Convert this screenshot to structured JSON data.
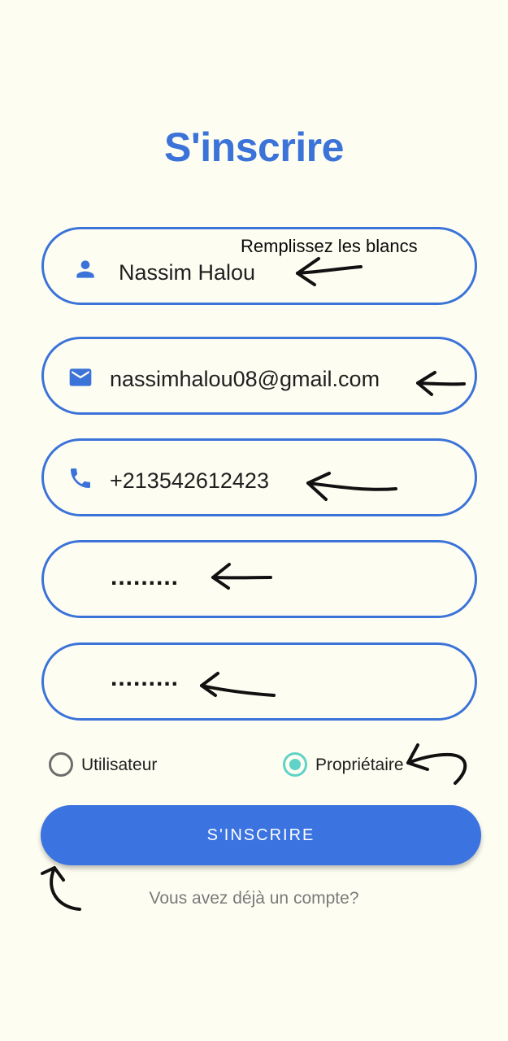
{
  "header": {
    "title": "S'inscrire"
  },
  "annotation": {
    "text": "Remplissez les blancs"
  },
  "form": {
    "name": {
      "value": "Nassim Halou",
      "icon": "person-icon"
    },
    "email": {
      "value": "nassimhalou08@gmail.com",
      "icon": "mail-icon"
    },
    "phone": {
      "value": "+213542612423",
      "icon": "phone-icon"
    },
    "password": {
      "value": "........."
    },
    "confirm_password": {
      "value": "........."
    }
  },
  "role": {
    "options": [
      {
        "label": "Utilisateur",
        "selected": false
      },
      {
        "label": "Propriétaire",
        "selected": true
      }
    ]
  },
  "submit": {
    "label": "S'INSCRIRE"
  },
  "footer": {
    "login_link": "Vous avez déjà un compte?"
  },
  "colors": {
    "background": "#fefdf2",
    "primary": "#3b73d9",
    "button": "#3b73e0",
    "radio_selected": "#5fd3c7",
    "radio_unselected": "#6d6d6d",
    "secondary_text": "#7a7a7a"
  }
}
